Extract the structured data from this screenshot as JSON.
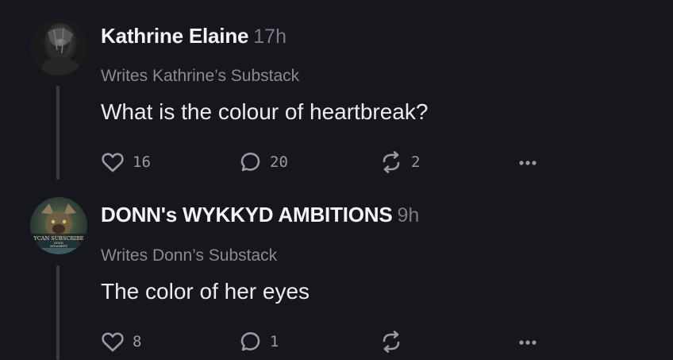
{
  "notes": [
    {
      "author": "Kathrine Elaine",
      "time": "17h",
      "byline": "Writes Kathrine’s Substack",
      "body": "What is the colour of heartbreak?",
      "likes": "16",
      "replies": "20",
      "restacks": "2",
      "avatar_icon": "veiled-figure-avatar"
    },
    {
      "author": "DONN's WYKKYD AMBITIONS",
      "time": "9h",
      "byline": "Writes Donn’s Substack",
      "body": "The color of her eyes",
      "likes": "8",
      "replies": "1",
      "restacks": "",
      "avatar_icon": "werewolf-art-avatar",
      "avatar_text": [
        "YCAN SUBSCRIBE",
        "DONN",
        "KYDAMBITI"
      ]
    }
  ],
  "icons": {
    "like": "heart-icon",
    "reply": "speech-bubble-icon",
    "restack": "restack-icon",
    "more": "more-dots-icon"
  },
  "colors": {
    "background": "#16161d",
    "thread_line": "#3a3a43",
    "muted_text": "#8a8a94"
  }
}
